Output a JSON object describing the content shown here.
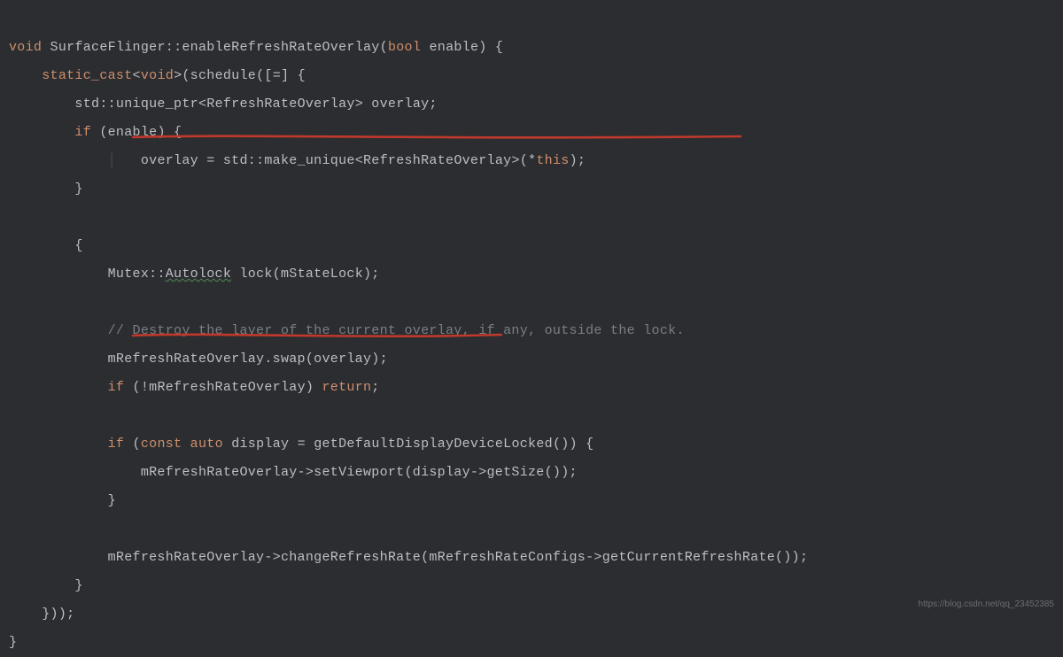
{
  "code": {
    "l1": {
      "kw1": "void",
      "cls": "SurfaceFlinger",
      "op": "::",
      "fn": "enableRefreshRateOverlay",
      "p1": "(",
      "kw2": "bool",
      "arg": "enable",
      "p2": ") {"
    },
    "l2": {
      "indent": "    ",
      "kw": "static_cast",
      "tpl": "<",
      "t": "void",
      "tpl2": ">(schedule([=] {"
    },
    "l3": {
      "indent": "        ",
      "ns": "std::unique_ptr",
      "tpl": "<",
      "t": "RefreshRateOverlay",
      "tpl2": "> overlay;"
    },
    "l4": {
      "indent": "        ",
      "kw": "if",
      "cond": " (enable) {"
    },
    "l5": {
      "indent": "            ",
      "lhs": "overlay = std::make_unique",
      "tpl": "<",
      "t": "RefreshRateOverlay",
      "tpl2": ">(",
      "star": "*",
      "this": "this",
      "end": ");"
    },
    "l6": {
      "indent": "        ",
      "close": "}"
    },
    "l7": "",
    "l8": {
      "indent": "        ",
      "open": "{"
    },
    "l9": {
      "indent": "            ",
      "t": "Mutex",
      "op": "::",
      "auto": "Autolock",
      "rest": " lock(mStateLock);"
    },
    "l10": "",
    "l11": {
      "indent": "            ",
      "c": "// Destroy the layer of the current overlay, if any, outside the lock."
    },
    "l12": {
      "indent": "            ",
      "txt": "mRefreshRateOverlay.swap(overlay);"
    },
    "l13": {
      "indent": "            ",
      "kw": "if",
      "cond": " (!mRefreshRateOverlay) ",
      "ret": "return",
      "semi": ";"
    },
    "l14": "",
    "l15": {
      "indent": "            ",
      "kw": "if",
      "p1": " (",
      "const": "const",
      "auto": "auto",
      "rest": " display = getDefaultDisplayDeviceLocked()) {"
    },
    "l16": {
      "indent": "                ",
      "txt": "mRefreshRateOverlay->setViewport(display->getSize());"
    },
    "l17": {
      "indent": "            ",
      "close": "}"
    },
    "l18": "",
    "l19": {
      "indent": "            ",
      "txt": "mRefreshRateOverlay->changeRefreshRate(mRefreshRateConfigs->getCurrentRefreshRate());"
    },
    "l20": {
      "indent": "        ",
      "close": "}"
    },
    "l21": {
      "indent": "    ",
      "close": "}));"
    },
    "l22": {
      "close": "}"
    }
  },
  "watermark": "https://blog.csdn.net/qq_23452385"
}
